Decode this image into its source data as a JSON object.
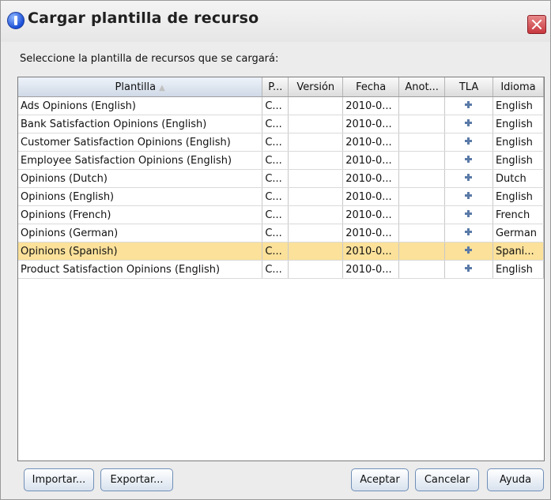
{
  "window": {
    "title": "Cargar plantilla de recurso"
  },
  "prompt": "Seleccione la plantilla de recursos que se cargará:",
  "table": {
    "columns": [
      "Plantilla",
      "P...",
      "Versión",
      "Fecha",
      "Anot...",
      "TLA",
      "Idioma"
    ],
    "sorted_column": "Plantilla",
    "rows": [
      {
        "plantilla": "Ads Opinions (English)",
        "p": "C...",
        "version": "",
        "fecha": "2010-0...",
        "anot": "",
        "idioma": "English",
        "selected": false
      },
      {
        "plantilla": "Bank Satisfaction Opinions (English)",
        "p": "C...",
        "version": "",
        "fecha": "2010-0...",
        "anot": "",
        "idioma": "English",
        "selected": false
      },
      {
        "plantilla": "Customer Satisfaction Opinions (English)",
        "p": "C...",
        "version": "",
        "fecha": "2010-0...",
        "anot": "",
        "idioma": "English",
        "selected": false
      },
      {
        "plantilla": "Employee Satisfaction Opinions (English)",
        "p": "C...",
        "version": "",
        "fecha": "2010-0...",
        "anot": "",
        "idioma": "English",
        "selected": false
      },
      {
        "plantilla": "Opinions (Dutch)",
        "p": "C...",
        "version": "",
        "fecha": "2010-0...",
        "anot": "",
        "idioma": "Dutch",
        "selected": false
      },
      {
        "plantilla": "Opinions (English)",
        "p": "C...",
        "version": "",
        "fecha": "2010-0...",
        "anot": "",
        "idioma": "English",
        "selected": false
      },
      {
        "plantilla": "Opinions (French)",
        "p": "C...",
        "version": "",
        "fecha": "2010-0...",
        "anot": "",
        "idioma": "French",
        "selected": false
      },
      {
        "plantilla": "Opinions (German)",
        "p": "C...",
        "version": "",
        "fecha": "2010-0...",
        "anot": "",
        "idioma": "German",
        "selected": false
      },
      {
        "plantilla": "Opinions (Spanish)",
        "p": "C...",
        "version": "",
        "fecha": "2010-0...",
        "anot": "",
        "idioma": "Spani...",
        "selected": true
      },
      {
        "plantilla": "Product Satisfaction Opinions (English)",
        "p": "C...",
        "version": "",
        "fecha": "2010-0...",
        "anot": "",
        "idioma": "English",
        "selected": false
      }
    ]
  },
  "buttons": {
    "importar": "Importar...",
    "exportar": "Exportar...",
    "aceptar": "Aceptar",
    "cancelar": "Cancelar",
    "ayuda": "Ayuda"
  },
  "colors": {
    "selected_row": "#fbe19a",
    "close_button": "#c7373f",
    "button_border": "#6f8fb8"
  }
}
